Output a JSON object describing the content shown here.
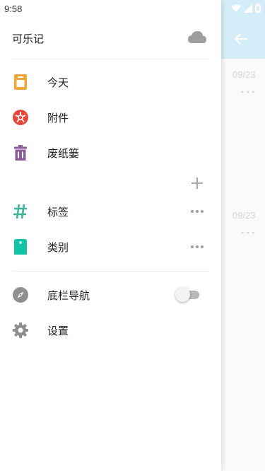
{
  "status_bar": {
    "time": "9:58"
  },
  "drawer": {
    "title": "可乐记",
    "main_items": [
      {
        "label": "今天",
        "icon": "calendar-icon",
        "color": "#f4a534"
      },
      {
        "label": "附件",
        "icon": "aperture-icon",
        "color": "#e8473c"
      },
      {
        "label": "废纸篓",
        "icon": "trash-icon",
        "color": "#8b5c9c"
      }
    ],
    "group_items": [
      {
        "label": "标签",
        "icon": "hashtag-icon",
        "color": "#3fb59a"
      },
      {
        "label": "类别",
        "icon": "tag-icon",
        "color": "#12c3a5"
      }
    ],
    "settings_items": [
      {
        "label": "底栏导航",
        "icon": "compass-icon",
        "color": "#8f8f8f",
        "toggle_on": false
      },
      {
        "label": "设置",
        "icon": "gear-icon",
        "color": "#8f8f8f"
      }
    ]
  },
  "background": {
    "dates": [
      "09/23",
      "09/23"
    ],
    "accent": "#d4edf9"
  }
}
